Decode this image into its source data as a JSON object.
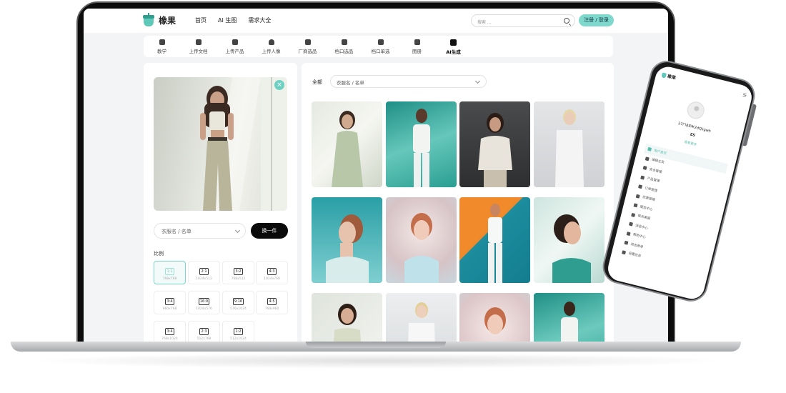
{
  "brand": {
    "name": "橡果",
    "accent": "#7ed8cb"
  },
  "nav": {
    "items": [
      "首页",
      "AI 生图",
      "需求大全"
    ]
  },
  "search": {
    "placeholder": "搜索 ..."
  },
  "auth": {
    "label": "注册 / 登录"
  },
  "tabs": [
    {
      "label": "教学",
      "icon": "teacher-icon"
    },
    {
      "label": "上传文档",
      "icon": "document-icon"
    },
    {
      "label": "上传产品",
      "icon": "shirt-icon"
    },
    {
      "label": "上传人像",
      "icon": "person-icon"
    },
    {
      "label": "厂商选品",
      "icon": "factory-icon"
    },
    {
      "label": "档口选品",
      "icon": "bag-icon"
    },
    {
      "label": "档口单选",
      "icon": "box-icon"
    },
    {
      "label": "图册",
      "icon": "image-icon"
    },
    {
      "label": "AI生成",
      "icon": "ai-icon",
      "active": true
    }
  ],
  "left_panel": {
    "select_placeholder": "衣服名 / 名单",
    "swap_label": "换一件",
    "ratio_title": "比例",
    "ratios": [
      {
        "key": "1:1",
        "size": "768x768",
        "selected": true
      },
      {
        "key": "2:1",
        "size": "1024x512"
      },
      {
        "key": "3:2",
        "size": "768x512"
      },
      {
        "key": "4:3",
        "size": "1024x768"
      },
      {
        "key": "3:4",
        "size": "960x768"
      },
      {
        "key": "16:9",
        "size": "1024x576"
      },
      {
        "key": "9:16",
        "size": "576x1024"
      },
      {
        "key": "4:5",
        "size": "768x960"
      },
      {
        "key": "3:4",
        "size": "768x1024"
      },
      {
        "key": "2:3",
        "size": "512x768"
      },
      {
        "key": "1:2",
        "size": "512x1024"
      }
    ]
  },
  "right_panel": {
    "all_label": "全部",
    "filter_placeholder": "衣服名 / 名单"
  },
  "phone": {
    "logo": "橡果",
    "user_id": "27ㄇ8ЯЖ2dQkgwh",
    "level": "ZS",
    "link": "查看更多",
    "menu": [
      {
        "label": "用户首页",
        "active": true
      },
      {
        "label": "编辑主页"
      },
      {
        "label": "安全管理"
      },
      {
        "label": "产品管理"
      },
      {
        "label": "订单管理"
      },
      {
        "label": "优惠管理"
      },
      {
        "label": "服务中心"
      },
      {
        "label": "联系客服"
      },
      {
        "label": "消息中心"
      },
      {
        "label": "帮助中心"
      },
      {
        "label": "退出登录"
      },
      {
        "label": "设置信息"
      }
    ]
  }
}
